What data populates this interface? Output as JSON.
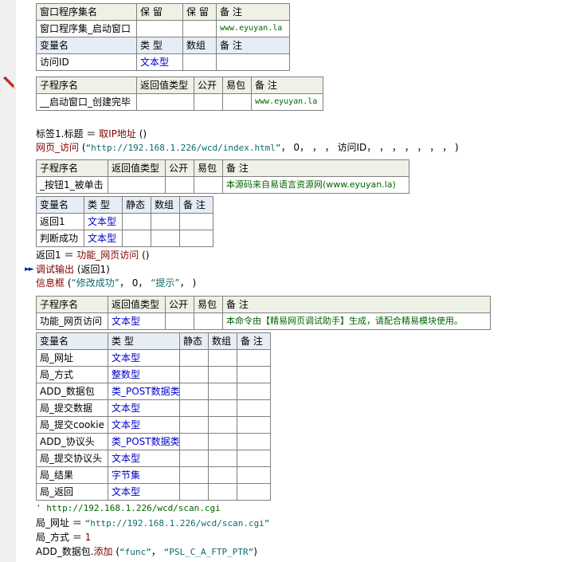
{
  "t1": {
    "headers": [
      "窗口程序集名",
      "保 留",
      "保 留",
      "备 注"
    ],
    "row": [
      "窗口程序集_启动窗口",
      "",
      "",
      "www.eyuyan.la"
    ],
    "var_headers": [
      "变量名",
      "类 型",
      "数组",
      "备 注"
    ],
    "var_row": [
      "访问ID",
      "文本型",
      "",
      ""
    ]
  },
  "t2": {
    "headers": [
      "子程序名",
      "返回值类型",
      "公开",
      "易包",
      "备 注"
    ],
    "row": [
      "__启动窗口_创建完毕",
      "",
      "",
      "",
      "www.eyuyan.la"
    ]
  },
  "code1": {
    "l1_a": "标签1.标题 ＝ ",
    "l1_b": "取IP地址",
    "l1_c": " ()",
    "l2_a": "网页_访问",
    "l2_b": " (",
    "l2_c": "“http://192.168.1.226/wcd/index.html”",
    "l2_d": "， 0， ， ， 访问ID， ， ， ， ， ， ， )"
  },
  "t3": {
    "headers": [
      "子程序名",
      "返回值类型",
      "公开",
      "易包",
      "备 注"
    ],
    "row": [
      "_按钮1_被单击",
      "",
      "",
      "",
      "本源码来自易语言资源网(www.eyuyan.la)"
    ]
  },
  "t4": {
    "headers": [
      "变量名",
      "类 型",
      "静态",
      "数组",
      "备 注"
    ],
    "rows": [
      [
        "返回1",
        "文本型"
      ],
      [
        "判断成功",
        "文本型"
      ]
    ]
  },
  "code2": {
    "l1_a": "返回1 ＝ ",
    "l1_b": "功能_网页访问",
    "l1_c": " ()",
    "l2_a": "调试输出",
    "l2_b": " (返回1)",
    "l3_a": "信息框",
    "l3_b": " (",
    "l3_c": "“修改成功”",
    "l3_d": "， 0， ",
    "l3_e": "“提示”",
    "l3_f": "， )"
  },
  "t5": {
    "headers": [
      "子程序名",
      "返回值类型",
      "公开",
      "易包",
      "备 注"
    ],
    "row": [
      "功能_网页访问",
      "文本型",
      "",
      "",
      "本命令由【精易网页调试助手】生成，请配合精易模块使用。"
    ]
  },
  "t6": {
    "headers": [
      "变量名",
      "类 型",
      "静态",
      "数组",
      "备 注"
    ],
    "rows": [
      [
        "局_网址",
        "文本型"
      ],
      [
        "局_方式",
        "整数型"
      ],
      [
        "ADD_数据包",
        "类_POST数据类"
      ],
      [
        "局_提交数据",
        "文本型"
      ],
      [
        "局_提交cookie",
        "文本型"
      ],
      [
        "ADD_协议头",
        "类_POST数据类"
      ],
      [
        "局_提交协议头",
        "文本型"
      ],
      [
        "局_结果",
        "字节集"
      ],
      [
        "局_返回",
        "文本型"
      ]
    ]
  },
  "code3": {
    "c1": "' http://192.168.1.226/wcd/scan.cgi",
    "l2_a": "局_网址 ＝ ",
    "l2_b": "“http://192.168.1.226/wcd/scan.cgi”",
    "l3_a": "局_方式 ＝ ",
    "l3_b": "1",
    "l4_a": "ADD_数据包.",
    "l4_b": "添加",
    "l4_c": " (",
    "l4_d": "“func”",
    "l4_e": "， ",
    "l4_f": "“PSL_C_A_FTP_PTR”",
    "l4_g": ")"
  }
}
